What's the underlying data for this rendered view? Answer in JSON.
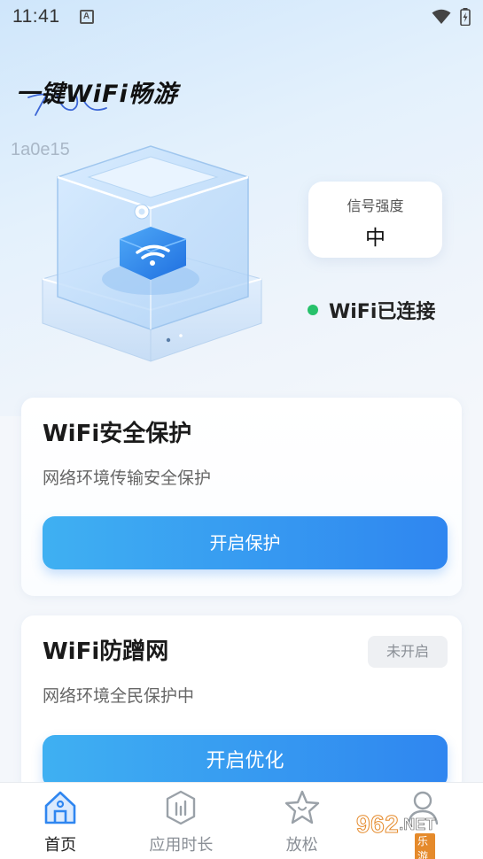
{
  "status_bar": {
    "time": "11:41",
    "notification_icon": "A",
    "icons": [
      "wifi-icon",
      "battery-icon"
    ]
  },
  "app": {
    "title": "一键WiFi畅游",
    "code": "1a0e15"
  },
  "signal": {
    "label": "信号强度",
    "value": "中"
  },
  "connection": {
    "text": "WiFi已连接",
    "color": "#27c16b"
  },
  "cards": [
    {
      "title": "WiFi安全保护",
      "description": "网络环境传输安全保护",
      "button_label": "开启保护"
    },
    {
      "title": "WiFi防蹭网",
      "description": "网络环境全民保护中",
      "badge": "未开启",
      "button_label": "开启优化"
    }
  ],
  "bottom_nav": {
    "items": [
      {
        "label": "首页",
        "icon": "home-icon",
        "active": true
      },
      {
        "label": "应用时长",
        "icon": "stats-icon",
        "active": false
      },
      {
        "label": "放松",
        "icon": "star-icon",
        "active": false
      },
      {
        "label": "",
        "icon": "profile-icon",
        "active": false
      }
    ]
  },
  "watermark": {
    "number": "962",
    "domain": ".NET",
    "sub": "乐游网"
  },
  "colors": {
    "accent": "#2f86f0",
    "accent_light": "#3fb0f2",
    "status_green": "#27c16b"
  }
}
